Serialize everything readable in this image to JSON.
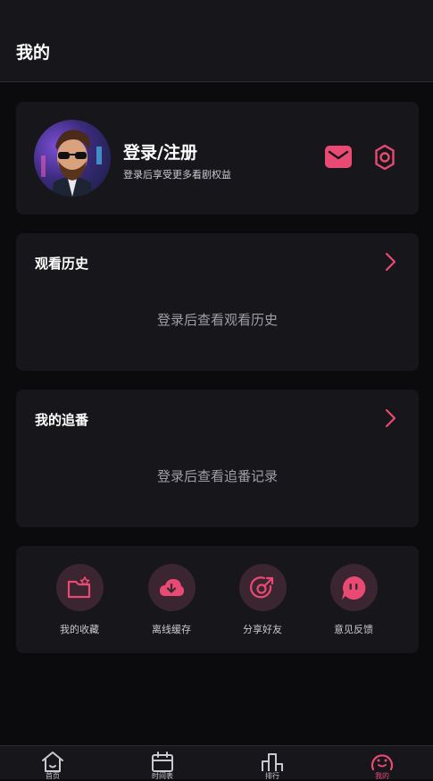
{
  "header": {
    "title": "我的"
  },
  "profile": {
    "login_title": "登录/注册",
    "login_subtitle": "登录后享受更多看剧权益",
    "mail_icon": "mail-icon",
    "settings_icon": "gear-icon"
  },
  "history": {
    "title": "观看历史",
    "empty_text": "登录后查看观看历史"
  },
  "follow": {
    "title": "我的追番",
    "empty_text": "登录后查看追番记录"
  },
  "tools": [
    {
      "label": "我的收藏",
      "icon": "favorite-folder-icon"
    },
    {
      "label": "离线缓存",
      "icon": "cloud-download-icon"
    },
    {
      "label": "分享好友",
      "icon": "share-icon"
    },
    {
      "label": "意见反馈",
      "icon": "feedback-chat-icon"
    }
  ],
  "tabbar": [
    {
      "label": "首页",
      "icon": "home-icon",
      "active": false
    },
    {
      "label": "时间表",
      "icon": "calendar-icon",
      "active": false
    },
    {
      "label": "排行",
      "icon": "ranking-icon",
      "active": false
    },
    {
      "label": "我的",
      "icon": "profile-smile-icon",
      "active": true
    }
  ],
  "colors": {
    "accent": "#e94a74",
    "background": "#0b0b0d",
    "card": "#17161b"
  }
}
